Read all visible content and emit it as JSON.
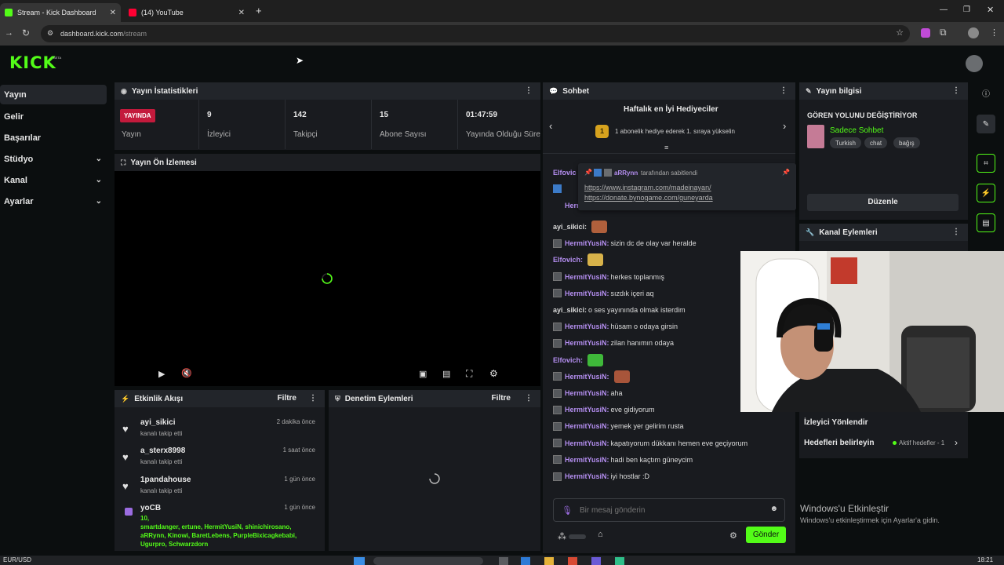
{
  "browser": {
    "tabs": [
      {
        "title": "Stream - Kick Dashboard",
        "active": true
      },
      {
        "title": "(14) YouTube",
        "active": false
      }
    ],
    "new_tab": "+",
    "url_host": "dashboard.kick.com",
    "url_path": "/stream"
  },
  "brand": {
    "logo": "KICK",
    "beta": "BETA",
    "accent": "#53fc18"
  },
  "sidebar": {
    "items": [
      {
        "label": "Yayın",
        "expandable": false
      },
      {
        "label": "Gelir",
        "expandable": false
      },
      {
        "label": "Başarılar",
        "expandable": false
      },
      {
        "label": "Stüdyo",
        "expandable": true
      },
      {
        "label": "Kanal",
        "expandable": true
      },
      {
        "label": "Ayarlar",
        "expandable": true
      }
    ]
  },
  "stats": {
    "title": "Yayın İstatistikleri",
    "live_badge": "YAYINDA",
    "live_label": "Yayın",
    "items": [
      {
        "value": "9",
        "label": "İzleyici"
      },
      {
        "value": "142",
        "label": "Takipçi"
      },
      {
        "value": "15",
        "label": "Abone Sayısı"
      },
      {
        "value": "01:47:59",
        "label": "Yayında Olduğu Süre"
      }
    ]
  },
  "preview": {
    "title": "Yayın Ön İzlemesi"
  },
  "activity": {
    "title": "Etkinlik Akışı",
    "filter": "Filtre",
    "events": [
      {
        "name": "ayi_sikici",
        "action": "kanalı takip etti",
        "time": "2 dakika önce",
        "icon": "heart-icon"
      },
      {
        "name": "a_sterx8998",
        "action": "kanalı takip etti",
        "time": "1 saat önce",
        "icon": "heart-icon"
      },
      {
        "name": "1pandahouse",
        "action": "kanalı takip etti",
        "time": "1 gün önce",
        "icon": "heart-icon"
      }
    ],
    "gift": {
      "name": "yoCB",
      "time": "1 gün önce",
      "count": "10,",
      "recipients": "smartdanger, ertune, HermitYusiN, shinichirosano, aRRynn, Kinowi, BaretLebens, PurpleBixicagkebabi, Ugurpro, Schwarzdorn",
      "icon": "gift-icon"
    }
  },
  "moderation": {
    "title": "Denetim Eylemleri",
    "filter": "Filtre"
  },
  "chat": {
    "title": "Sohbet",
    "gifters_title": "Haftalık en İyi Hediyeciler",
    "gifters_rank": "1",
    "gifters_text": "1 abonelik hediye ederek 1. sıraya yükselin",
    "pinned": {
      "user": "aRRynn",
      "suffix": "tarafından sabitlendi",
      "link1": "https://www.instagram.com/madeinayan/",
      "link2": "https://donate.bynogame.com/guneyarda"
    },
    "behind_pinned": {
      "line1": "Elfovic",
      "line2": "Herm"
    },
    "messages": [
      {
        "user": "ayi_sikici:",
        "text": "",
        "style": "g",
        "emote": "#b0603c",
        "avatar": false
      },
      {
        "user": "HermitYusiN:",
        "text": "sizin dc de olay var heralde",
        "style": "p",
        "avatar": true
      },
      {
        "user": "Elfovich:",
        "text": "",
        "style": "p",
        "emote": "#d7b24a",
        "avatar": false
      },
      {
        "user": "HermitYusiN:",
        "text": "herkes toplanmış",
        "style": "p",
        "avatar": true
      },
      {
        "user": "HermitYusiN:",
        "text": "sızdık içeri aq",
        "style": "p",
        "avatar": true
      },
      {
        "user": "ayi_sikici:",
        "text": "o ses yayınında olmak isterdim",
        "style": "g",
        "avatar": false
      },
      {
        "user": "HermitYusiN:",
        "text": "hüsam o odaya girsin",
        "style": "p",
        "avatar": true
      },
      {
        "user": "HermitYusiN:",
        "text": "zilan hanımın odaya",
        "style": "p",
        "avatar": true
      },
      {
        "user": "Elfovich:",
        "text": "",
        "style": "p",
        "emote": "#3fb83a",
        "avatar": false
      },
      {
        "user": "HermitYusiN:",
        "text": "",
        "style": "p",
        "emote": "#a8553a",
        "avatar": true
      },
      {
        "user": "HermitYusiN:",
        "text": "aha",
        "style": "p",
        "avatar": true
      },
      {
        "user": "HermitYusiN:",
        "text": "eve gidiyorum",
        "style": "p",
        "avatar": true
      },
      {
        "user": "HermitYusiN:",
        "text": "yemek yer gelirim rusta",
        "style": "p",
        "avatar": true
      },
      {
        "user": "HermitYusiN:",
        "text": "kapatıyorum dükkanı hemen eve geçiyorum",
        "style": "p",
        "avatar": true
      },
      {
        "user": "HermitYusiN:",
        "text": "hadi ben kaçtım güneycim",
        "style": "p",
        "avatar": true
      },
      {
        "user": "HermitYusiN:",
        "text": "iyi hostlar :D",
        "style": "p",
        "avatar": true
      }
    ],
    "input_placeholder": "Bir mesaj gönderin",
    "send_label": "Gönder"
  },
  "stream_info": {
    "title": "Yayın bilgisi",
    "stream_title": "GÖREN YOLUNU DEĞİŞTİRİYOR",
    "category": "Sadece Sohbet",
    "tags": [
      "Turkish",
      "chat",
      "bağış"
    ],
    "edit_label": "Düzenle"
  },
  "channel_actions": {
    "title": "Kanal Eylemleri"
  },
  "viewer_redirect": {
    "title": "İzleyici Yönlendir",
    "goals_label": "Hedefleri belirleyin",
    "active_goals": "Aktif hedefler - 1"
  },
  "watermark": {
    "title": "Windows'u Etkinleştir",
    "subtitle": "Windows'u etkinleştirmek için Ayarlar'a gidin."
  },
  "taskbar": {
    "left": "EUR/USD",
    "time": "18:21"
  }
}
